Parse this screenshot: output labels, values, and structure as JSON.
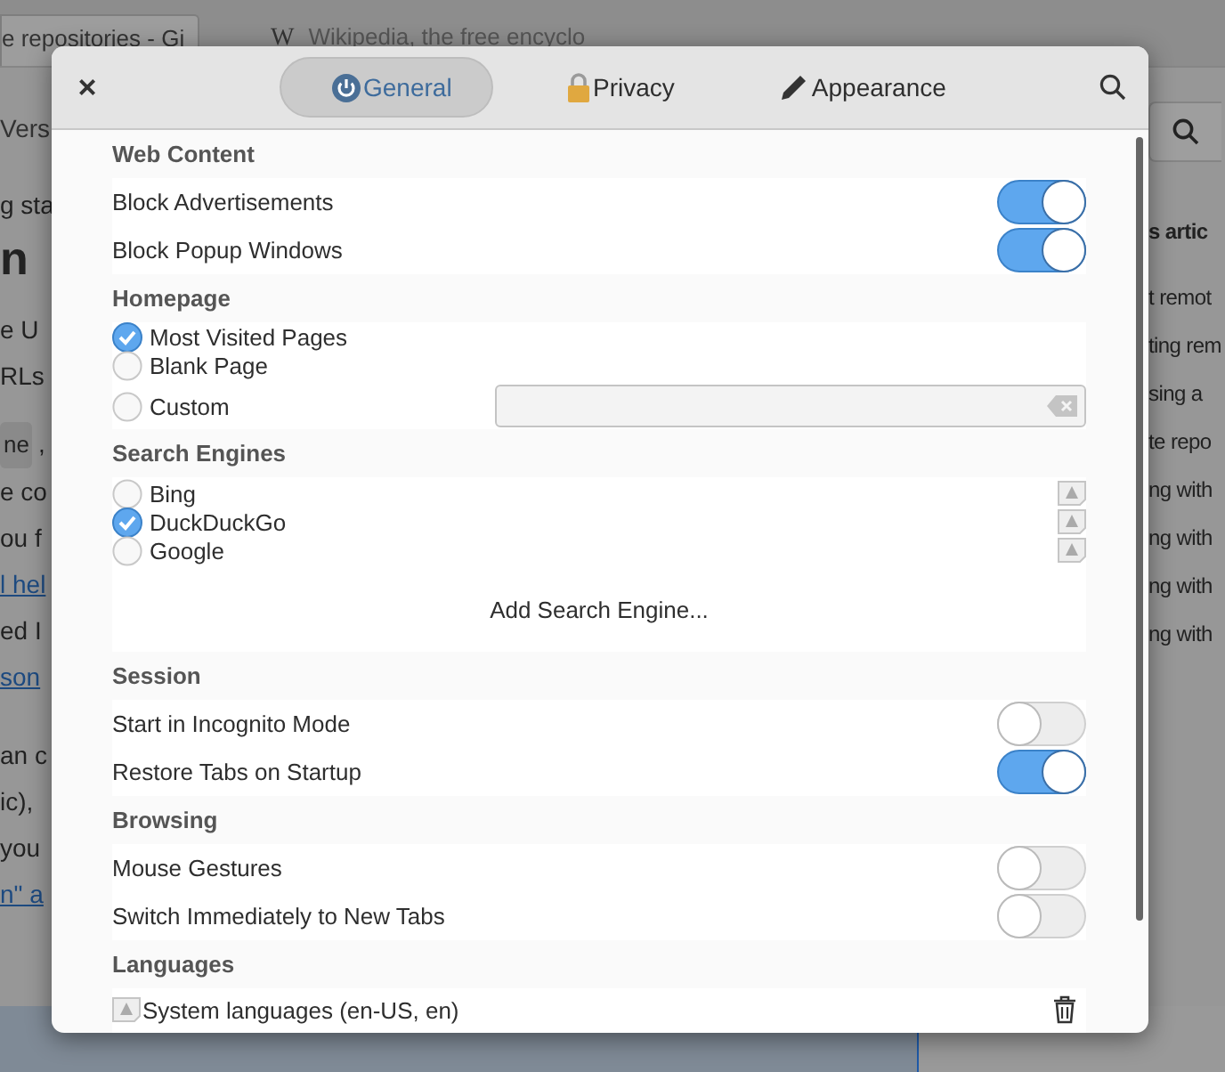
{
  "background": {
    "tabs": [
      {
        "title": "e repositories - Gi",
        "selected": true
      },
      {
        "title": "Wikipedia, the free encyclo",
        "selected": false,
        "glyph": "W"
      }
    ],
    "toolbar_text": "Vers",
    "left_lines": [
      {
        "kind": "text",
        "text": "g sta"
      },
      {
        "kind": "heading",
        "text": "n"
      },
      {
        "kind": "text",
        "text": "e U"
      },
      {
        "kind": "text",
        "text": "RLs"
      },
      {
        "kind": "code",
        "text": "ne",
        "after": ","
      },
      {
        "kind": "text",
        "text": "e co"
      },
      {
        "kind": "text",
        "text": "ou f"
      },
      {
        "kind": "link",
        "text": "l hel"
      },
      {
        "kind": "text",
        "text": "ed I"
      },
      {
        "kind": "link",
        "text": "son"
      },
      {
        "kind": "text",
        "text": "an c"
      },
      {
        "kind": "text",
        "text": "ic),"
      },
      {
        "kind": "text",
        "text": "you"
      },
      {
        "kind": "link",
        "text": "n\" a"
      }
    ],
    "right_lines": [
      {
        "kind": "heading",
        "text": "s artic"
      },
      {
        "kind": "text",
        "text": "t remot"
      },
      {
        "kind": "text",
        "text": "ting rem"
      },
      {
        "kind": "text",
        "text": "sing a"
      },
      {
        "kind": "text",
        "text": "te repo"
      },
      {
        "kind": "text",
        "text": "ng with"
      },
      {
        "kind": "text",
        "text": "ng with"
      },
      {
        "kind": "text",
        "text": "ng with"
      },
      {
        "kind": "text",
        "text": "ng with"
      }
    ]
  },
  "dialog": {
    "close": "×",
    "tabs": [
      {
        "label": "General",
        "selected": true
      },
      {
        "label": "Privacy",
        "selected": false
      },
      {
        "label": "Appearance",
        "selected": false
      }
    ],
    "sections": [
      {
        "title": "Web Content",
        "rows": [
          {
            "kind": "toggle",
            "label": "Block Advertisements",
            "on": true
          },
          {
            "kind": "toggle",
            "label": "Block Popup Windows",
            "on": true
          }
        ]
      },
      {
        "title": "Homepage",
        "rows": [
          {
            "kind": "radio",
            "label": "Most Visited Pages",
            "selected": true
          },
          {
            "kind": "radio",
            "label": "Blank Page",
            "selected": false
          },
          {
            "kind": "radio_field",
            "label": "Custom",
            "selected": false
          }
        ]
      },
      {
        "title": "Search Engines",
        "rows": [
          {
            "kind": "engine",
            "label": "Bing",
            "selected": false
          },
          {
            "kind": "engine",
            "label": "DuckDuckGo",
            "selected": true
          },
          {
            "kind": "engine",
            "label": "Google",
            "selected": false
          },
          {
            "kind": "add",
            "label": "Add Search Engine..."
          }
        ]
      },
      {
        "title": "Session",
        "rows": [
          {
            "kind": "toggle",
            "label": "Start in Incognito Mode",
            "on": false
          },
          {
            "kind": "toggle",
            "label": "Restore Tabs on Startup",
            "on": true
          }
        ]
      },
      {
        "title": "Browsing",
        "rows": [
          {
            "kind": "toggle",
            "label": "Mouse Gestures",
            "on": false
          },
          {
            "kind": "toggle",
            "label": "Switch Immediately to New Tabs",
            "on": false
          }
        ]
      },
      {
        "title": "Languages",
        "rows": [
          {
            "kind": "language",
            "label": "System languages (en-US, en)"
          }
        ]
      }
    ]
  }
}
